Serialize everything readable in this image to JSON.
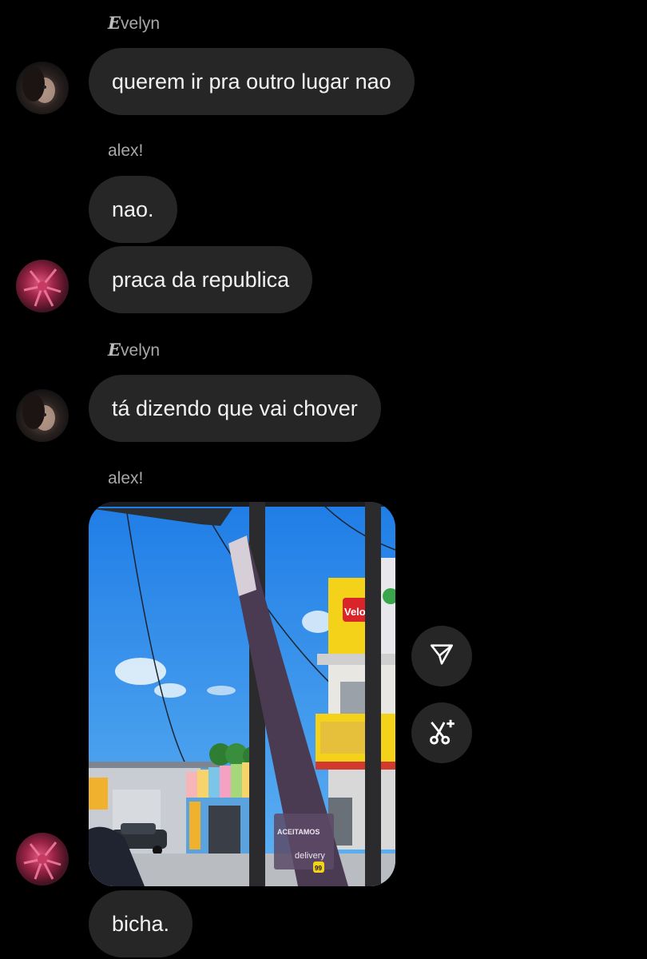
{
  "messages": [
    {
      "sender_initial": "E",
      "sender_rest": "velyn",
      "text": "querem ir pra outro lugar nao"
    },
    {
      "sender": "alex!",
      "text": "nao."
    },
    {
      "text": "praca da republica"
    },
    {
      "sender_initial": "E",
      "sender_rest": "velyn",
      "text": "tá dizendo que vai chover"
    },
    {
      "sender": "alex!",
      "text": "bicha."
    }
  ],
  "photo": {
    "sign_text": "Veloz",
    "banner_accept": "ACEITAMOS",
    "banner_delivery": "delivery",
    "banner_99": "99"
  },
  "icons": {
    "share": "send-icon",
    "remix": "scissors-sparkle-icon"
  }
}
